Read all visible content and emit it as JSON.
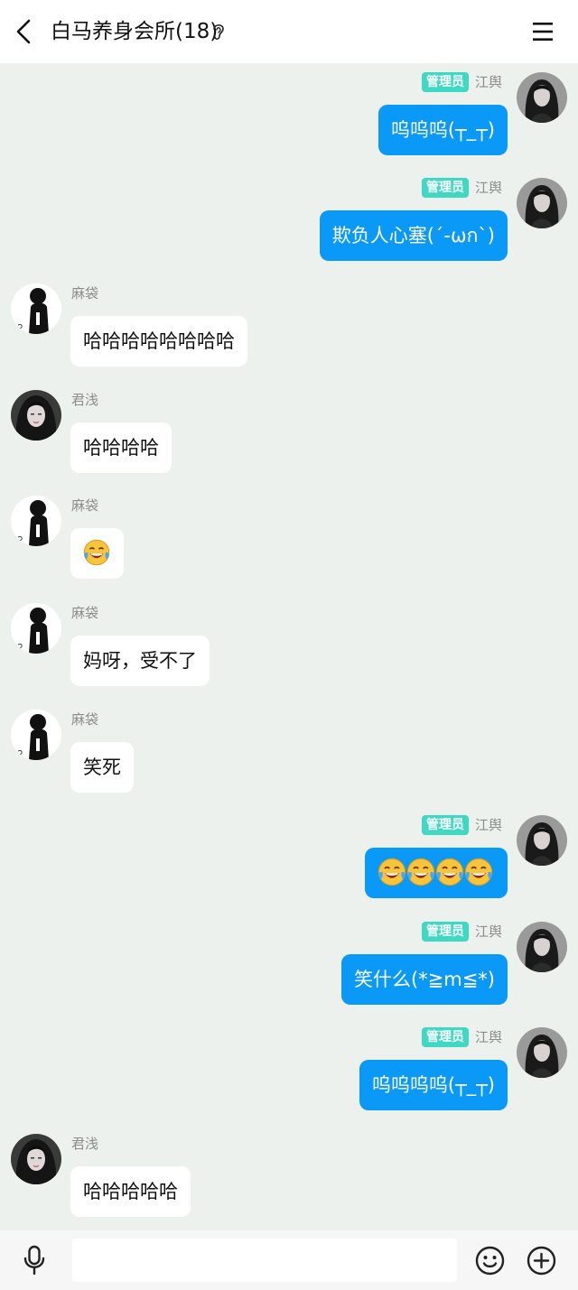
{
  "header": {
    "title": "白马养身会所(18)",
    "back_icon": "chevron-left-icon",
    "mute_icon": "ear-icon",
    "menu_icon": "hamburger-menu-icon"
  },
  "badge_label": "管理员",
  "colors": {
    "background": "#edf1ee",
    "outgoing_bubble": "#0a99f7",
    "incoming_bubble": "#ffffff",
    "admin_badge": "#3ed8c3"
  },
  "messages": [
    {
      "side": "right",
      "sender": "江舆",
      "admin": true,
      "text": "呜呜呜(┬_┬)"
    },
    {
      "side": "right",
      "sender": "江舆",
      "admin": true,
      "text": "欺负人心塞(´-ωก`)"
    },
    {
      "side": "left",
      "sender": "麻袋",
      "admin": false,
      "text": "哈哈哈哈哈哈哈哈"
    },
    {
      "side": "left",
      "sender": "君浅",
      "admin": false,
      "text": "哈哈哈哈"
    },
    {
      "side": "left",
      "sender": "麻袋",
      "admin": false,
      "text": "",
      "emoji": [
        "laughing-tears-emoji"
      ]
    },
    {
      "side": "left",
      "sender": "麻袋",
      "admin": false,
      "text": "妈呀，受不了"
    },
    {
      "side": "left",
      "sender": "麻袋",
      "admin": false,
      "text": "笑死"
    },
    {
      "side": "right",
      "sender": "江舆",
      "admin": true,
      "text": "",
      "emoji": [
        "crying-emoji",
        "crying-emoji",
        "crying-emoji",
        "crying-emoji"
      ]
    },
    {
      "side": "right",
      "sender": "江舆",
      "admin": true,
      "text": "笑什么(*≧m≦*)"
    },
    {
      "side": "right",
      "sender": "江舆",
      "admin": true,
      "text": "呜呜呜呜(┬_┬)"
    },
    {
      "side": "left",
      "sender": "君浅",
      "admin": false,
      "text": "哈哈哈哈哈"
    }
  ],
  "input_bar": {
    "placeholder": "",
    "value": "",
    "icons": [
      "microphone-icon",
      "smiley-icon",
      "plus-icon"
    ]
  }
}
